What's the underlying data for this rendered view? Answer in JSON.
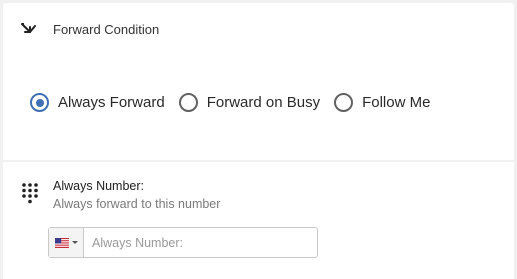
{
  "forward_condition": {
    "icon": "forward-arrow-icon",
    "title": "Forward Condition",
    "options": [
      {
        "label": "Always Forward",
        "checked": true
      },
      {
        "label": "Forward on Busy",
        "checked": false
      },
      {
        "label": "Follow Me",
        "checked": false
      }
    ]
  },
  "always_number": {
    "icon": "dialpad-icon",
    "title": "Always Number:",
    "subtitle": "Always forward to this number",
    "country_flag": "us-flag-icon",
    "input_value": "",
    "input_placeholder": "Always Number:"
  },
  "colors": {
    "accent": "#3f6fb5",
    "background": "#f1f1f1"
  }
}
